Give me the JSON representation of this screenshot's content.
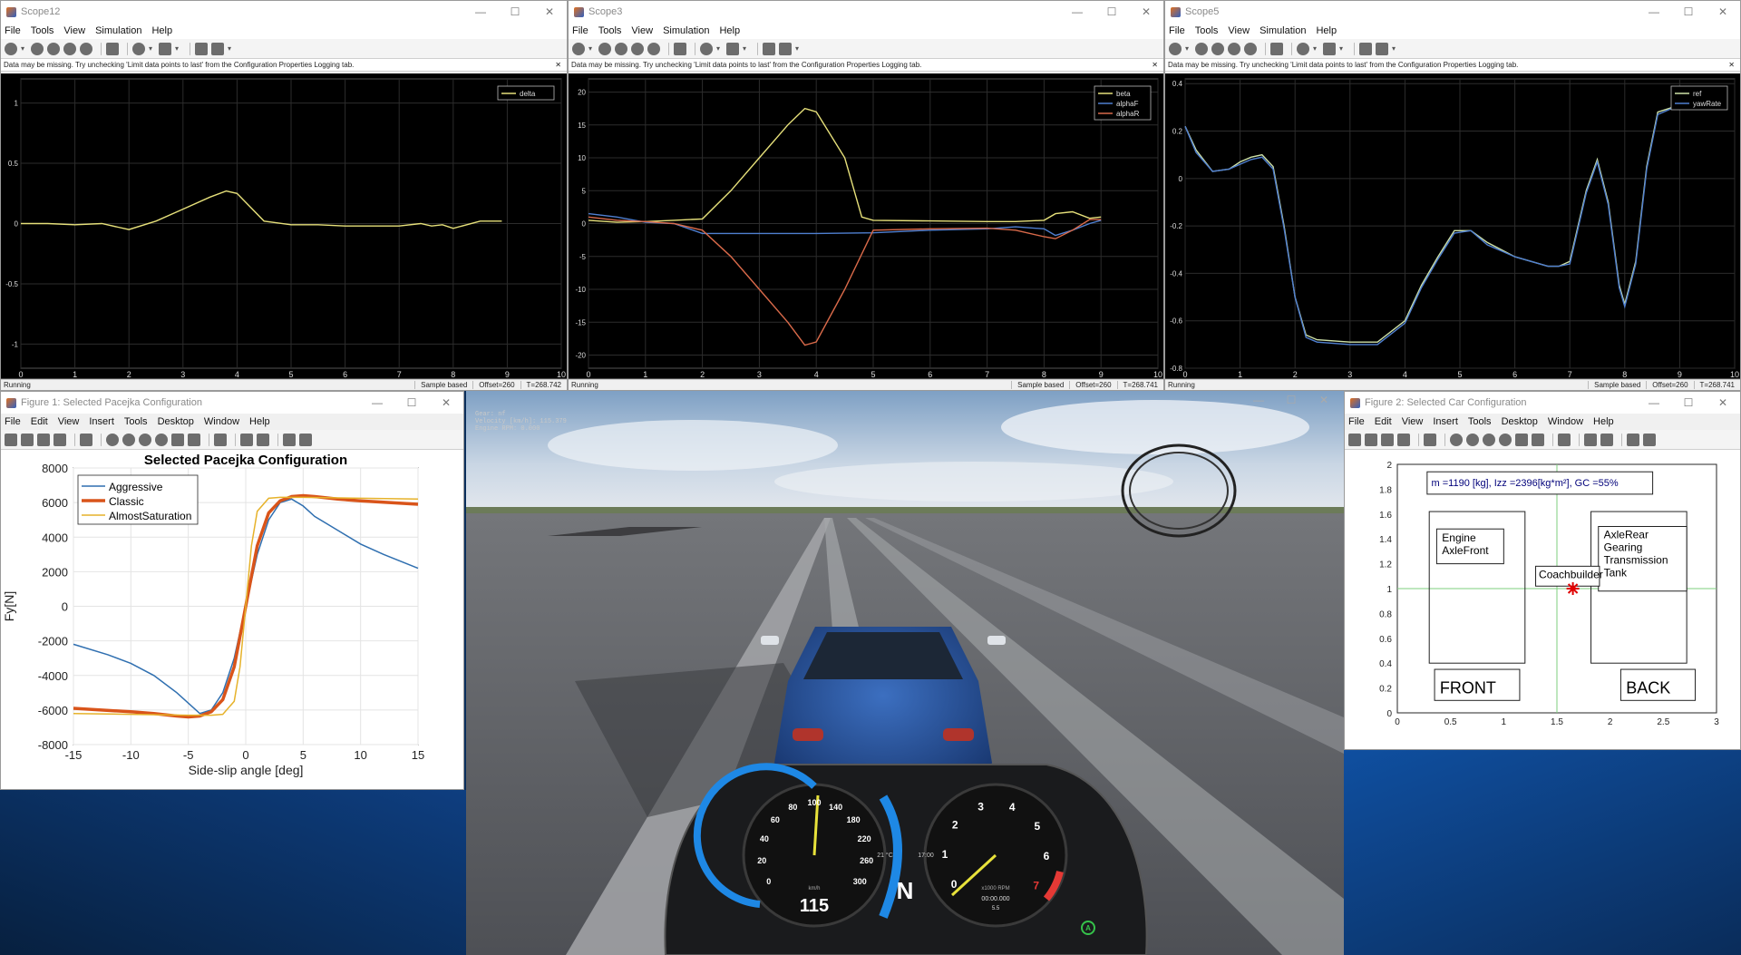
{
  "scope12": {
    "title": "Scope12",
    "menu": [
      "File",
      "Tools",
      "View",
      "Simulation",
      "Help"
    ],
    "message": "Data may be missing.  Try unchecking 'Limit data points to last' from the Configuration Properties Logging tab.",
    "status": "Running",
    "sample": "Sample based",
    "offset": "Offset=260",
    "time": "T=268.742"
  },
  "scope3": {
    "title": "Scope3",
    "menu": [
      "File",
      "Tools",
      "View",
      "Simulation",
      "Help"
    ],
    "message": "Data may be missing.  Try unchecking 'Limit data points to last' from the Configuration Properties Logging tab.",
    "status": "Running",
    "sample": "Sample based",
    "offset": "Offset=260",
    "time": "T=268.741"
  },
  "scope5": {
    "title": "Scope5",
    "menu": [
      "File",
      "Tools",
      "View",
      "Simulation",
      "Help"
    ],
    "message": "Data may be missing.  Try unchecking 'Limit data points to last' from the Configuration Properties Logging tab.",
    "status": "Running",
    "sample": "Sample based",
    "offset": "Offset=260",
    "time": "T=268.741"
  },
  "fig1": {
    "title": "Figure 1: Selected Pacejka Configuration",
    "menu": [
      "File",
      "Edit",
      "View",
      "Insert",
      "Tools",
      "Desktop",
      "Window",
      "Help"
    ]
  },
  "fig2": {
    "title": "Figure 2: Selected Car Configuration",
    "menu": [
      "File",
      "Edit",
      "View",
      "Insert",
      "Tools",
      "Desktop",
      "Window",
      "Help"
    ],
    "info": "m =1190 [kg], Izz =2396[kg*m²], GC =55%",
    "front_box": [
      "Engine",
      "AxleFront"
    ],
    "rear_box": [
      "AxleRear",
      "Gearing",
      "Transmission",
      "Tank"
    ],
    "cg_label": "Coachbuilder",
    "front_label": "FRONT",
    "back_label": "BACK"
  },
  "sim": {
    "hud": [
      "Gear: nf",
      "Velocity [km/h]: 115.379",
      "Engine RPM: 0.000"
    ],
    "speed": "115",
    "gear": "N",
    "speed_unit": "km/h",
    "rpm_unit": "x1000 RPM",
    "clock": "17:00",
    "temp": "21 °C",
    "timer": "00:00.000",
    "odo": "5.5",
    "mode": "A"
  },
  "colors": {
    "yellow": "#e6e07a",
    "blue": "#4f7fd0",
    "red": "#d96a4a",
    "matlab_blue": "#2f6fb0",
    "matlab_orange": "#d9541a",
    "matlab_yellow": "#e6b22a"
  },
  "chart_data": [
    {
      "type": "line",
      "name": "Scope12",
      "x_ticks": [
        0,
        1,
        2,
        3,
        4,
        5,
        6,
        7,
        8,
        9,
        10
      ],
      "y_ticks": [
        -1,
        -0.5,
        0,
        0.5,
        1
      ],
      "xlim": [
        0,
        10
      ],
      "ylim": [
        -1.2,
        1.2
      ],
      "legend": [
        "delta"
      ],
      "legend_position": "top-right",
      "grid": true,
      "series": [
        {
          "name": "delta",
          "color": "#e6e07a",
          "x": [
            0,
            0.5,
            1,
            1.5,
            1.8,
            2,
            2.5,
            3,
            3.5,
            3.8,
            4,
            4.5,
            5,
            5.5,
            6,
            6.5,
            7,
            7.4,
            7.6,
            7.8,
            8,
            8.5,
            8.9
          ],
          "y": [
            0,
            0,
            -0.01,
            0,
            -0.03,
            -0.05,
            0.02,
            0.12,
            0.22,
            0.27,
            0.25,
            0.02,
            -0.01,
            -0.01,
            -0.02,
            -0.02,
            -0.02,
            0.0,
            -0.02,
            -0.01,
            -0.04,
            0.02,
            0.02
          ]
        }
      ]
    },
    {
      "type": "line",
      "name": "Scope3",
      "x_ticks": [
        0,
        1,
        2,
        3,
        4,
        5,
        6,
        7,
        8,
        9,
        10
      ],
      "y_ticks": [
        -20,
        -15,
        -10,
        -5,
        0,
        5,
        10,
        15,
        20
      ],
      "xlim": [
        0,
        10
      ],
      "ylim": [
        -22,
        22
      ],
      "legend": [
        "beta",
        "alphaF",
        "alphaR"
      ],
      "legend_position": "top-right",
      "grid": true,
      "series": [
        {
          "name": "beta",
          "color": "#e6e07a",
          "x": [
            0,
            0.5,
            1,
            1.5,
            2,
            2.5,
            3,
            3.5,
            3.8,
            4,
            4.5,
            4.8,
            5,
            6,
            7,
            7.5,
            8,
            8.2,
            8.5,
            8.8,
            9
          ],
          "y": [
            0.5,
            0.2,
            0.3,
            0.5,
            0.7,
            5,
            10,
            15,
            17.5,
            17,
            10,
            1,
            0.5,
            0.4,
            0.3,
            0.3,
            0.5,
            1.5,
            1.8,
            0.8,
            1
          ]
        },
        {
          "name": "alphaF",
          "color": "#4f7fd0",
          "x": [
            0,
            0.5,
            1,
            1.5,
            2,
            3,
            4,
            5,
            6,
            7,
            7.5,
            8,
            8.2,
            8.5,
            8.8,
            9
          ],
          "y": [
            1.5,
            1,
            0.2,
            0,
            -1.5,
            -1.5,
            -1.5,
            -1.4,
            -1,
            -0.8,
            -0.5,
            -0.8,
            -1.8,
            -1,
            0,
            0.5
          ]
        },
        {
          "name": "alphaR",
          "color": "#d96a4a",
          "x": [
            0,
            0.5,
            1,
            1.5,
            2,
            2.5,
            3,
            3.5,
            3.8,
            4,
            4.5,
            5,
            6,
            7,
            7.5,
            8,
            8.2,
            8.5,
            8.8,
            9
          ],
          "y": [
            1,
            0.5,
            0.3,
            0,
            -1,
            -5,
            -10,
            -15,
            -18.5,
            -18,
            -10,
            -1,
            -0.8,
            -0.7,
            -1,
            -2,
            -2.3,
            -1,
            0.6,
            0.6
          ]
        }
      ]
    },
    {
      "type": "line",
      "name": "Scope5",
      "x_ticks": [
        0,
        1,
        2,
        3,
        4,
        5,
        6,
        7,
        8,
        9,
        10
      ],
      "y_ticks": [
        -0.8,
        -0.6,
        -0.4,
        -0.2,
        0,
        0.2,
        0.4
      ],
      "xlim": [
        0,
        10
      ],
      "ylim": [
        -0.8,
        0.42
      ],
      "legend": [
        "ref",
        "yawRate"
      ],
      "legend_position": "top-right",
      "grid": true,
      "series": [
        {
          "name": "ref",
          "color": "#cfe2a8",
          "x": [
            0,
            0.2,
            0.5,
            0.8,
            1,
            1.2,
            1.4,
            1.6,
            1.8,
            2,
            2.2,
            2.4,
            3,
            3.5,
            4,
            4.3,
            4.6,
            4.9,
            5.2,
            5.5,
            6,
            6.3,
            6.6,
            6.8,
            7,
            7.3,
            7.5,
            7.7,
            7.9,
            8,
            8.2,
            8.4,
            8.6,
            9,
            9.5
          ],
          "y": [
            0.22,
            0.12,
            0.03,
            0.04,
            0.07,
            0.09,
            0.1,
            0.05,
            -0.2,
            -0.5,
            -0.66,
            -0.68,
            -0.69,
            -0.69,
            -0.6,
            -0.45,
            -0.33,
            -0.22,
            -0.22,
            -0.27,
            -0.33,
            -0.35,
            -0.37,
            -0.37,
            -0.35,
            -0.05,
            0.08,
            -0.1,
            -0.45,
            -0.53,
            -0.35,
            0.05,
            0.28,
            0.31,
            0.31
          ]
        },
        {
          "name": "yawRate",
          "color": "#4f7fd0",
          "x": [
            0,
            0.2,
            0.5,
            0.8,
            1,
            1.2,
            1.4,
            1.6,
            1.8,
            2,
            2.2,
            2.4,
            3,
            3.5,
            4,
            4.3,
            4.6,
            4.9,
            5.2,
            5.5,
            6,
            6.3,
            6.6,
            6.8,
            7,
            7.3,
            7.5,
            7.7,
            7.9,
            8,
            8.2,
            8.4,
            8.6,
            9,
            9.5
          ],
          "y": [
            0.22,
            0.11,
            0.03,
            0.04,
            0.06,
            0.08,
            0.09,
            0.04,
            -0.21,
            -0.5,
            -0.67,
            -0.69,
            -0.7,
            -0.7,
            -0.61,
            -0.46,
            -0.34,
            -0.23,
            -0.22,
            -0.28,
            -0.33,
            -0.35,
            -0.37,
            -0.37,
            -0.36,
            -0.06,
            0.07,
            -0.11,
            -0.46,
            -0.54,
            -0.36,
            0.04,
            0.27,
            0.31,
            0.31
          ]
        }
      ]
    },
    {
      "type": "line",
      "name": "Pacejka",
      "title": "Selected Pacejka Configuration",
      "xlabel": "Side-slip angle [deg]",
      "ylabel": "Fy[N]",
      "xlim": [
        -15,
        15
      ],
      "ylim": [
        -8000,
        8000
      ],
      "x_ticks": [
        -15,
        -10,
        -5,
        0,
        5,
        10,
        15
      ],
      "y_ticks": [
        -8000,
        -6000,
        -4000,
        -2000,
        0,
        2000,
        4000,
        6000,
        8000
      ],
      "legend": [
        "Aggressive",
        "Classic",
        "AlmostSaturation"
      ],
      "legend_position": "top-left",
      "grid": true,
      "series": [
        {
          "name": "Aggressive",
          "color": "#2f6fb0",
          "width": 1.5,
          "x": [
            -15,
            -12,
            -10,
            -8,
            -6,
            -4,
            -3,
            -2,
            -1,
            0,
            1,
            2,
            3,
            4,
            5,
            6,
            8,
            10,
            12,
            15
          ],
          "y": [
            -2200,
            -2800,
            -3300,
            -4000,
            -5000,
            -6200,
            -6000,
            -5000,
            -3000,
            0,
            3000,
            5000,
            6000,
            6200,
            5800,
            5200,
            4400,
            3600,
            3000,
            2200
          ]
        },
        {
          "name": "Classic",
          "color": "#d9541a",
          "width": 3.5,
          "x": [
            -15,
            -10,
            -8,
            -6,
            -5,
            -4,
            -3,
            -2,
            -1,
            0,
            1,
            2,
            3,
            4,
            5,
            6,
            8,
            10,
            15
          ],
          "y": [
            -5900,
            -6100,
            -6200,
            -6350,
            -6400,
            -6350,
            -6100,
            -5400,
            -3500,
            0,
            3500,
            5400,
            6100,
            6350,
            6400,
            6350,
            6200,
            6100,
            5900
          ]
        },
        {
          "name": "AlmostSaturation",
          "color": "#e6b22a",
          "width": 1.5,
          "x": [
            -15,
            -10,
            -5,
            -3,
            -2,
            -1,
            -0.5,
            0,
            0.5,
            1,
            2,
            3,
            5,
            10,
            15
          ],
          "y": [
            -6200,
            -6250,
            -6300,
            -6300,
            -6250,
            -5500,
            -3500,
            0,
            3500,
            5500,
            6250,
            6300,
            6300,
            6250,
            6200
          ]
        }
      ]
    },
    {
      "type": "scatter",
      "name": "CarConfiguration",
      "xlim": [
        0,
        3
      ],
      "ylim": [
        0,
        2
      ],
      "x_ticks": [
        0,
        0.5,
        1,
        1.5,
        2,
        2.5,
        3
      ],
      "y_ticks": [
        0,
        0.2,
        0.4,
        0.6,
        0.8,
        1,
        1.2,
        1.4,
        1.6,
        1.8,
        2
      ],
      "grid": false,
      "series": [
        {
          "name": "",
          "color": "#e00000",
          "x": [
            1.65
          ],
          "y": [
            1.0
          ]
        }
      ]
    }
  ]
}
